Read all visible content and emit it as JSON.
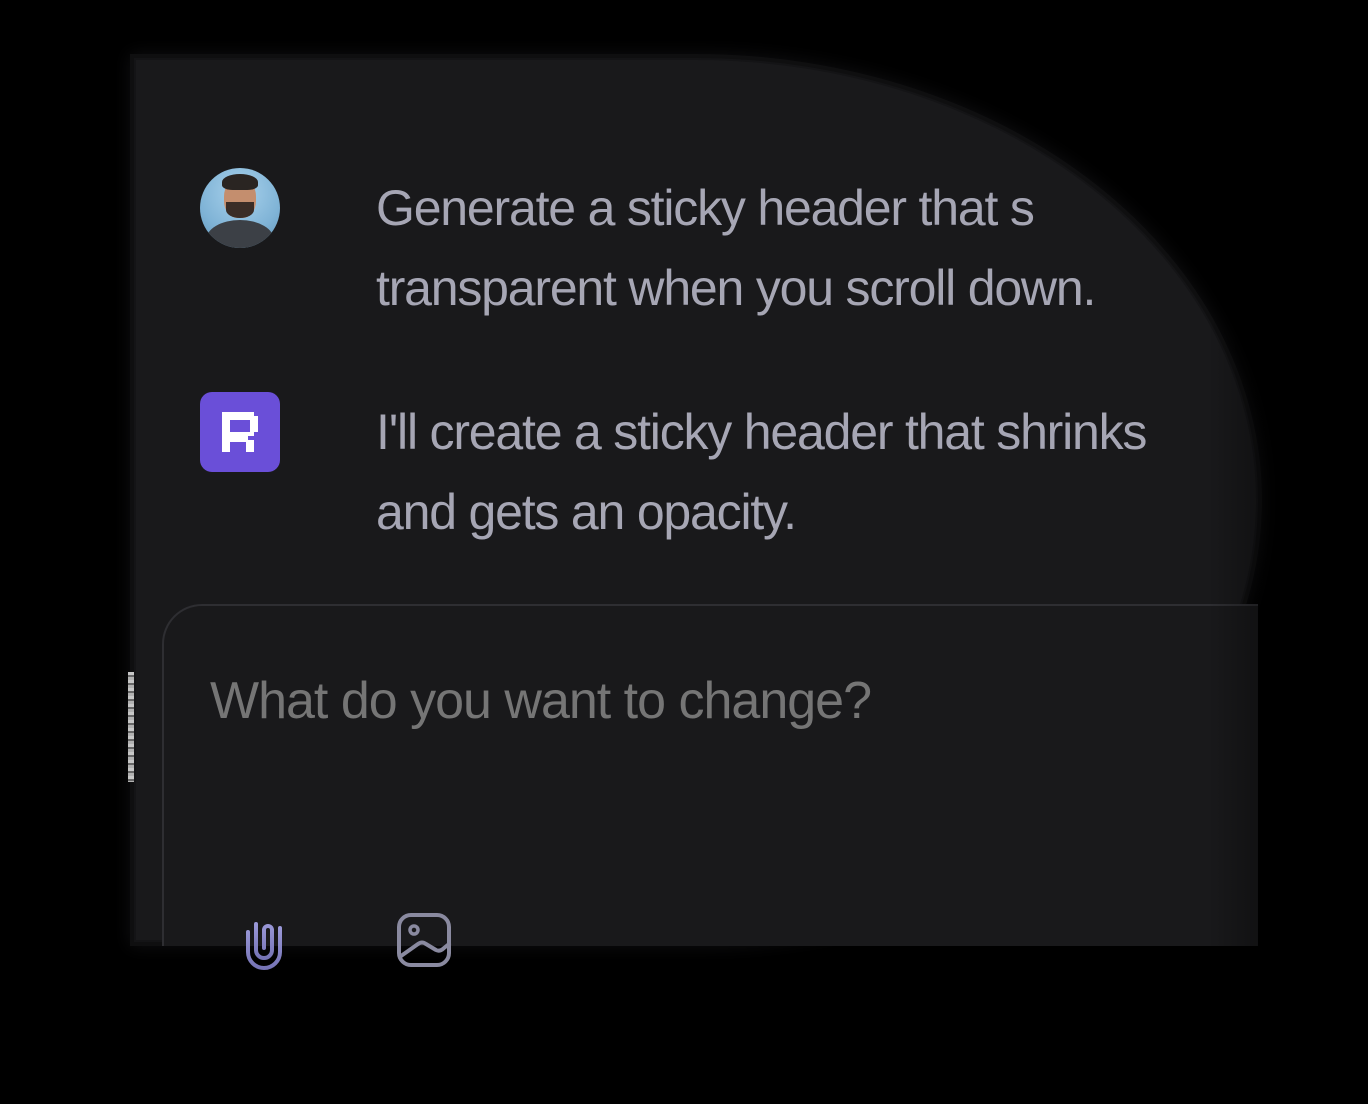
{
  "conversation": {
    "user_message": "Generate a sticky header that s\ntransparent when you scroll down.",
    "assistant_message": "I'll create a sticky header that shrinks\nand gets an opacity."
  },
  "composer": {
    "placeholder": "What do you want to change?",
    "attach_icon": "paperclip-icon",
    "image_icon": "image-icon"
  },
  "colors": {
    "background": "#000000",
    "panel": "#19191b",
    "accent": "#6a4fd8",
    "message_text": "#a6a6b4",
    "input_text": "#ffffff",
    "icon": "#8a88c4"
  }
}
